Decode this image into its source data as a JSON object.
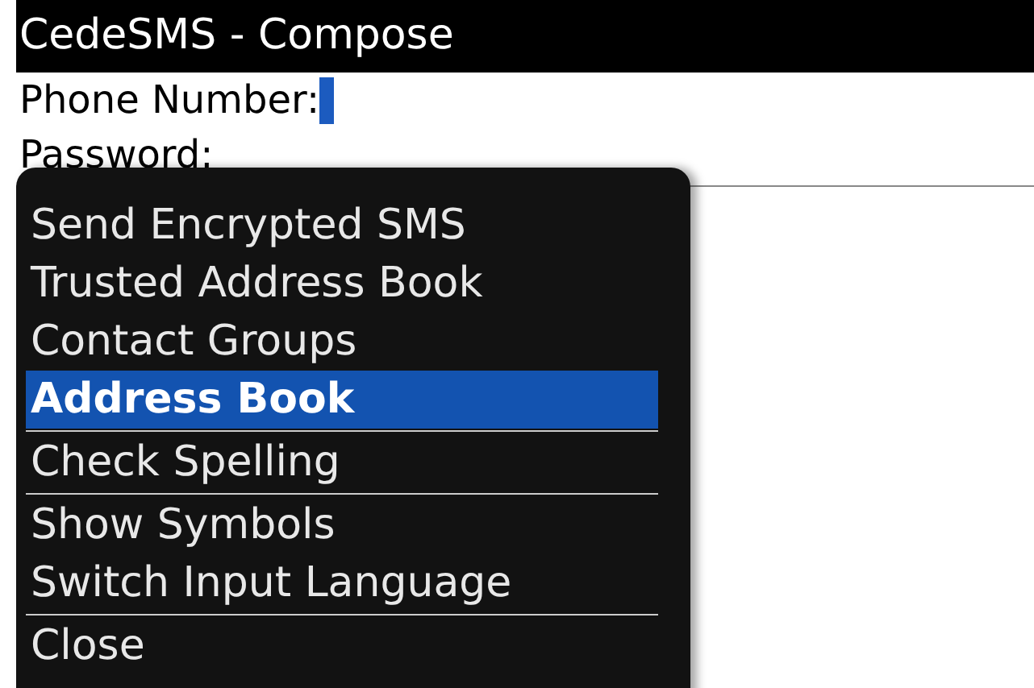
{
  "window": {
    "title": "CedeSMS - Compose"
  },
  "fields": [
    {
      "label": "Phone Number:",
      "focused": true
    },
    {
      "label": "Password:",
      "focused": false
    }
  ],
  "menu": {
    "groups": [
      [
        {
          "label": "Send Encrypted SMS",
          "selected": false
        },
        {
          "label": "Trusted Address Book",
          "selected": false
        },
        {
          "label": "Contact Groups",
          "selected": false
        },
        {
          "label": "Address Book",
          "selected": true
        }
      ],
      [
        {
          "label": "Check Spelling",
          "selected": false
        }
      ],
      [
        {
          "label": "Show Symbols",
          "selected": false
        },
        {
          "label": "Switch Input Language",
          "selected": false
        }
      ],
      [
        {
          "label": "Close",
          "selected": false
        }
      ]
    ]
  }
}
